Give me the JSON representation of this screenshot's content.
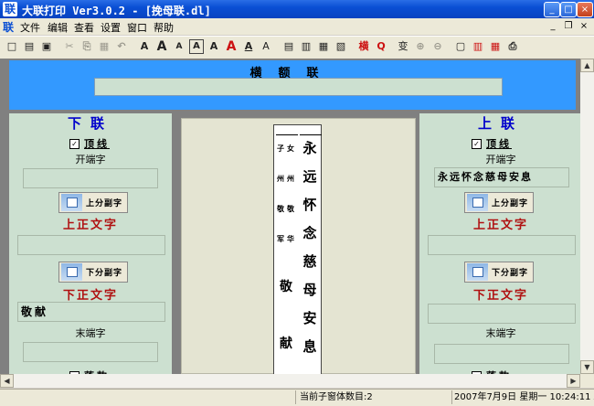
{
  "window": {
    "title": "大联打印 Ver3.0.2 - [挽母联.dl]",
    "buttons": {
      "minimize": "_",
      "maximize": "□",
      "close": "×"
    }
  },
  "menu": [
    "文件",
    "编辑",
    "查看",
    "设置",
    "窗口",
    "帮助"
  ],
  "mdi_buttons": {
    "minimize": "_",
    "restore": "❐",
    "close": "×"
  },
  "toolbar": {
    "glyphs": [
      "□",
      "▤",
      "▣",
      "✂",
      "⎘",
      "▦",
      "↶",
      "A",
      "A",
      "A",
      "A",
      "A",
      "A",
      "A",
      "A",
      "▤",
      "▥",
      "▦",
      "▧",
      "横",
      "Q",
      "变",
      "⊕",
      "⊖",
      "▢",
      "▥",
      "▦",
      "⎙"
    ]
  },
  "hengpi": {
    "label": "横额联",
    "value": ""
  },
  "lower_panel": {
    "header": "下联",
    "checkbox_label": "顶线",
    "checked": true,
    "start_label": "开端字",
    "start_value": "",
    "button1": "上分副字",
    "text_label_1": "上正文字",
    "text_value_1": "",
    "button2": "下分副字",
    "text_label_2": "下正文字",
    "text_value_2": "敬献",
    "end_label": "末端字",
    "end_value": "",
    "bottom_label": "落款"
  },
  "upper_panel": {
    "header": "上联",
    "checkbox_label": "顶线",
    "checked": true,
    "start_label": "开端字",
    "start_value": "永远怀念慈母安息",
    "button1": "上分副字",
    "text_label_1": "上正文字",
    "text_value_1": "",
    "button2": "下分副字",
    "text_label_2": "下正文字",
    "text_value_2": "",
    "end_label": "末端字",
    "end_value": "",
    "bottom_label": "落款"
  },
  "preview": {
    "main": [
      "永",
      "远",
      "怀",
      "念",
      "慈",
      "母",
      "安",
      "息"
    ],
    "minor_left": [
      "子",
      "州",
      "敬",
      "军"
    ],
    "minor_right": [
      "女",
      "州",
      "敬",
      "华"
    ],
    "bottom_left": [
      "敬",
      "献"
    ]
  },
  "status": {
    "child_count": "当前子窗体数目:2",
    "datetime": "2007年7月9日 星期一 10:24:11 AM"
  }
}
